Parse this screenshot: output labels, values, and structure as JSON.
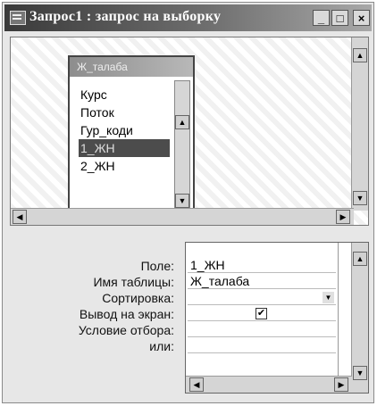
{
  "window": {
    "title": "Запрос1 : запрос на выборку",
    "btn_minimize": "_",
    "btn_maximize": "□",
    "btn_close": "×"
  },
  "field_list": {
    "title": "Ж_талаба",
    "items": [
      "Курс",
      "Поток",
      "Гур_коди",
      "1_ЖН",
      "2_ЖН"
    ],
    "selected": "1_ЖН"
  },
  "design_grid": {
    "row_labels": {
      "field": "Поле:",
      "table": "Имя таблицы:",
      "sort": "Сортировка:",
      "show": "Вывод на экран:",
      "criteria": "Условие отбора:",
      "or": "или:"
    },
    "column1": {
      "field": "1_ЖН",
      "table": "Ж_талаба",
      "sort": "",
      "show_checked": "✔",
      "criteria": "",
      "or": ""
    }
  },
  "icons": {
    "app": "query-window-icon",
    "arrow_up": "▲",
    "arrow_down": "▼",
    "arrow_left": "◀",
    "arrow_right": "▶"
  }
}
